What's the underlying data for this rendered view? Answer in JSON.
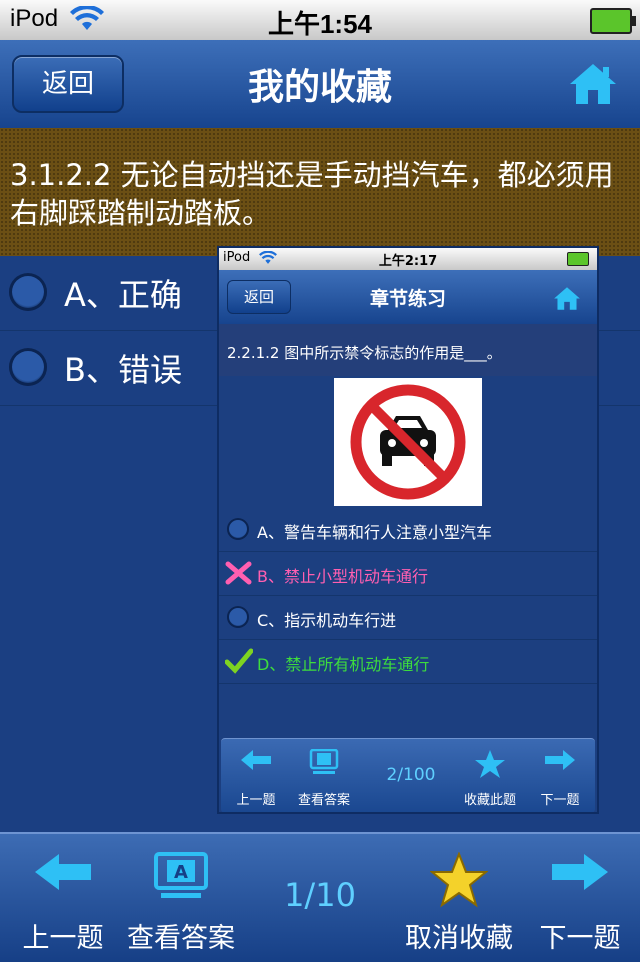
{
  "status_bar": {
    "carrier": "iPod",
    "time": "上午1:54"
  },
  "nav": {
    "back_label": "返回",
    "title": "我的收藏"
  },
  "question": {
    "text": "3.1.2.2 无论自动挡还是手动挡汽车，都必须用右脚踩踏制动踏板。"
  },
  "options": [
    {
      "label": "A、正确"
    },
    {
      "label": "B、错误"
    }
  ],
  "inset": {
    "status_bar": {
      "carrier": "iPod",
      "time": "上午2:17"
    },
    "nav": {
      "back_label": "返回",
      "title": "章节练习"
    },
    "question": "2.2.1.2 图中所示禁令标志的作用是___。",
    "options": [
      {
        "label": "A、警告车辆和行人注意小型汽车",
        "color": "#ffffff"
      },
      {
        "label": "B、禁止小型机动车通行",
        "color": "#ff5fb0"
      },
      {
        "label": "C、指示机动车行进",
        "color": "#ffffff"
      },
      {
        "label": "D、禁止所有机动车通行",
        "color": "#3ddc3d"
      }
    ],
    "toolbar": {
      "prev": "上一题",
      "answer": "查看答案",
      "page": "2/100",
      "favorite": "收藏此题",
      "next": "下一题"
    }
  },
  "toolbar": {
    "prev": "上一题",
    "answer": "查看答案",
    "page": "1/10",
    "unfavorite": "取消收藏",
    "next": "下一题"
  },
  "colors": {
    "accent": "#1fb6f0",
    "star": "#f4d22a"
  }
}
